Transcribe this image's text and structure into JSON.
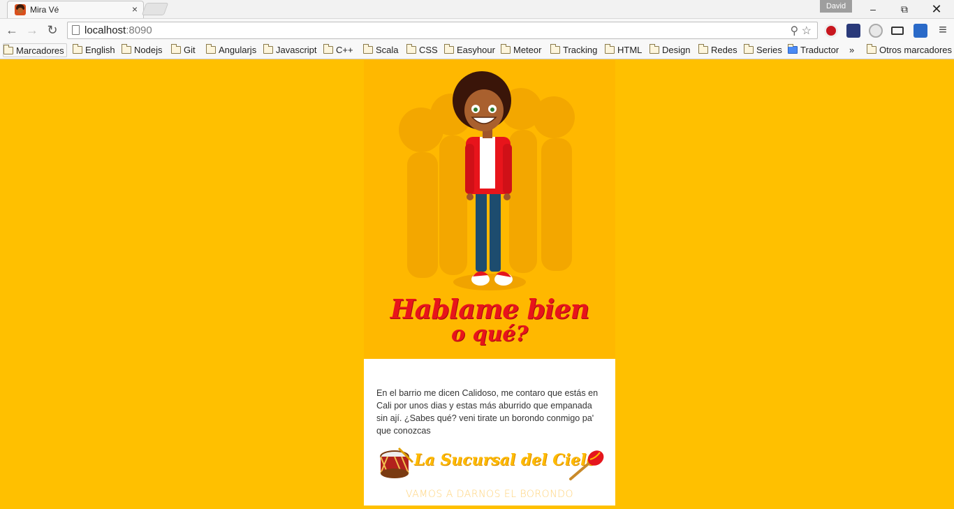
{
  "browser": {
    "tab_title": "Mira Vé",
    "tab_close": "×",
    "user_name": "David",
    "url_host": "localhost",
    "url_port": ":8090",
    "bookmarks": [
      "Marcadores",
      "English",
      "Nodejs",
      "Git",
      "Angularjs",
      "Javascript",
      "C++",
      "Scala",
      "CSS",
      "Easyhour",
      "Meteor",
      "Tracking",
      "HTML",
      "Design",
      "Redes",
      "Series",
      "Traductor"
    ],
    "more_label": "»",
    "other_bookmarks": "Otros marcadores"
  },
  "hero": {
    "headline_line1": "Hablame bien",
    "headline_line2": "o qué?"
  },
  "card": {
    "story": "En el barrio me dicen Calidoso, me contaro que estás en Cali por unos dias y estas más aburrido que empanada sin ají. ¿Sabes qué? veni tirate un borondo conmigo pa' que conozcas",
    "logo_text": "La Sucursal del Cielo",
    "tagline": "VAMOS A DARNOS EL BORONDO"
  },
  "colors": {
    "page_bg": "#ffc000",
    "hero_bg": "#ffb800",
    "headline": "#e8141b",
    "logo": "#ffbb00"
  }
}
